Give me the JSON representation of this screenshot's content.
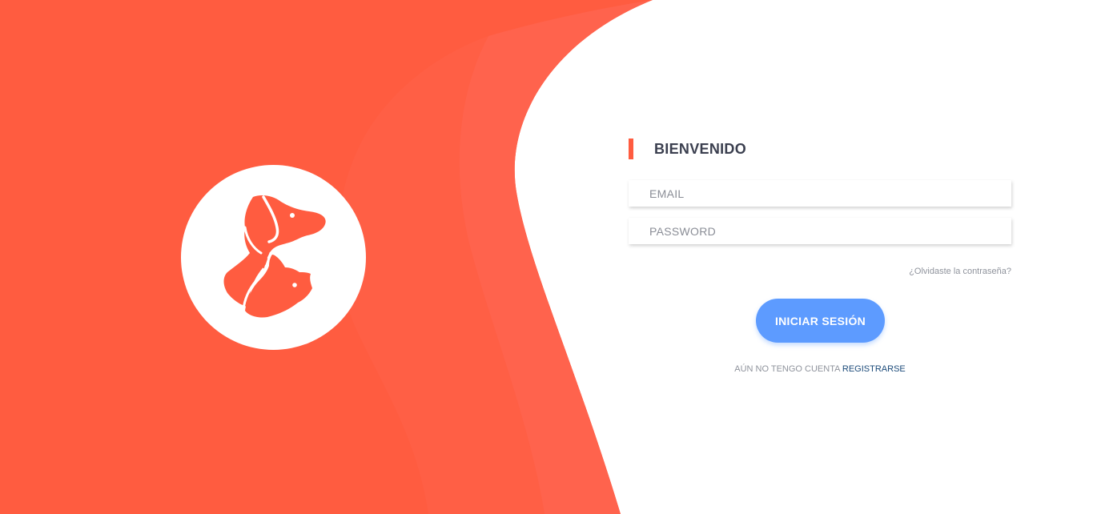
{
  "brand": {
    "logo_icon": "dog-and-cat-icon",
    "primary_color": "#ff5c40",
    "accent_color": "#5d9bff"
  },
  "login": {
    "title": "BIENVENIDO",
    "email_placeholder": "EMAIL",
    "password_placeholder": "PASSWORD",
    "forgot_label": "¿Olvidaste la contraseña?",
    "submit_label": "INICIAR SESIÓN",
    "no_account_text": "AÚN NO TENGO CUENTA",
    "register_label": "REGISTRARSE"
  }
}
